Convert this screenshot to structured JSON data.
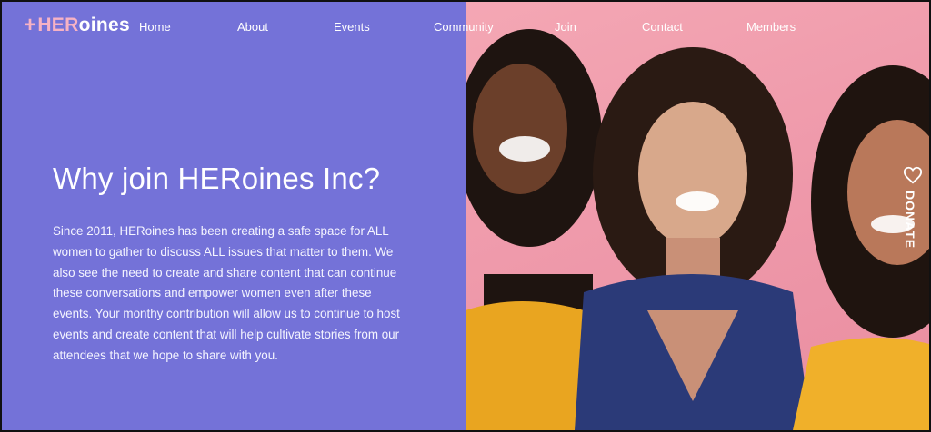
{
  "brand": {
    "plus": "+",
    "her": "HER",
    "rest": "oines"
  },
  "nav": {
    "items": [
      {
        "label": "Home"
      },
      {
        "label": "About"
      },
      {
        "label": "Events"
      },
      {
        "label": "Community"
      },
      {
        "label": "Join"
      },
      {
        "label": "Contact"
      },
      {
        "label": "Members"
      }
    ]
  },
  "hero": {
    "title": "Why join HERoines Inc?",
    "body": "Since 2011, HERoines has been creating a safe space for ALL women to gather to discuss ALL issues that matter to them. We also see the need to create and share content that can continue these conversations and empower women even after these events. Your monthy contribution will allow us to continue to host events and create content that will help cultivate stories from our attendees that we hope to share with you."
  },
  "donate": {
    "label": "DONATE",
    "icon": "heart-icon"
  },
  "colors": {
    "left_panel": "#7472d8",
    "accent_pink": "#f7b2c4",
    "photo_bg": "#ef9aab"
  }
}
